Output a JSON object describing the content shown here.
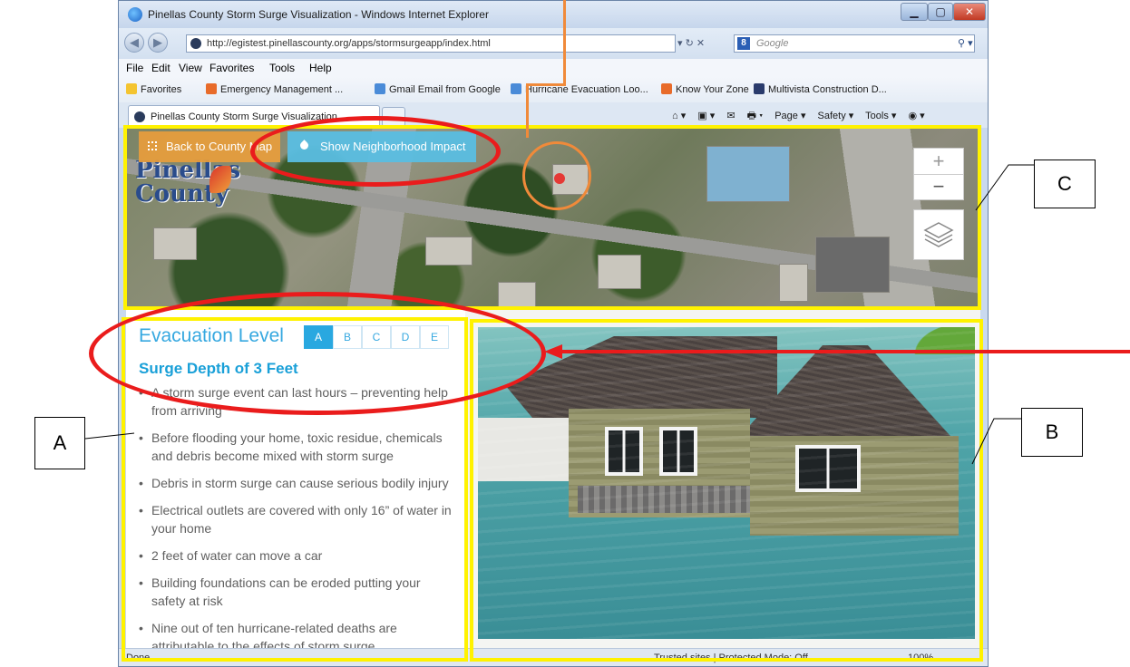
{
  "window": {
    "title": "Pinellas County Storm Surge Visualization - Windows Internet Explorer",
    "minimize_glyph": "▁",
    "maximize_glyph": "▢",
    "close_glyph": "✕"
  },
  "nav": {
    "back_glyph": "◀",
    "forward_glyph": "▶",
    "address": "http://egistest.pinellascounty.org/apps/stormsurgeapp/index.html",
    "address_tools": "▾ ↻ ✕",
    "search_engine_glyph": "8",
    "search_placeholder": "Google",
    "search_glyph": "⚲ ▾"
  },
  "menu": {
    "items": [
      "File",
      "Edit",
      "View",
      "Favorites",
      "Tools",
      "Help"
    ]
  },
  "favorites_bar": {
    "favorites_label": "Favorites",
    "links": [
      "Emergency Management ...",
      "Gmail Email from Google",
      "Hurricane Evacuation Loo...",
      "Know Your Zone",
      "Multivista Construction D..."
    ]
  },
  "tabs": {
    "active_label": "Pinellas County Storm Surge Visualization",
    "commands": [
      "⌂ ▾",
      "▣ ▾",
      "✉",
      "🖶 ▾",
      "Page ▾",
      "Safety ▾",
      "Tools ▾",
      "◉ ▾"
    ]
  },
  "map": {
    "back_button": "Back to County Map",
    "neighborhood_button": "Show Neighborhood Impact",
    "logo_text_1": "Pinellas",
    "logo_text_2": "County",
    "zoom_in": "+",
    "zoom_out": "−",
    "layers_icon": "layers-icon"
  },
  "panel": {
    "evac_title": "Evacuation Level",
    "levels": [
      "A",
      "B",
      "C",
      "D",
      "E"
    ],
    "active_level": "A",
    "surge_title": "Surge Depth of 3 Feet",
    "bullet_glyph": "•",
    "bullets": [
      "A storm surge event can last hours – preventing help from arriving",
      "Before flooding your home, toxic residue, chemicals and debris become mixed with storm surge",
      "Debris in storm surge can cause serious bodily injury",
      "Electrical outlets are covered with only 16” of water in your home",
      "2 feet of water can move a car",
      "Building foundations can be eroded putting your safety at risk",
      "Nine out of ten hurricane-related deaths are attributable to the effects of storm surge"
    ]
  },
  "status": {
    "left": "Done",
    "zone": "Trusted sites | Protected Mode: Off",
    "zoom": "100%"
  },
  "annotations": {
    "label_a": "A",
    "label_b": "B",
    "label_c": "C"
  },
  "colors": {
    "accent_blue": "#36a8e0",
    "orange_button": "#e89d3c",
    "teal_button": "#5abee1",
    "highlight_yellow": "#fff200",
    "highlight_red": "#ea1c1c",
    "orange_marker": "#f08a3a"
  }
}
